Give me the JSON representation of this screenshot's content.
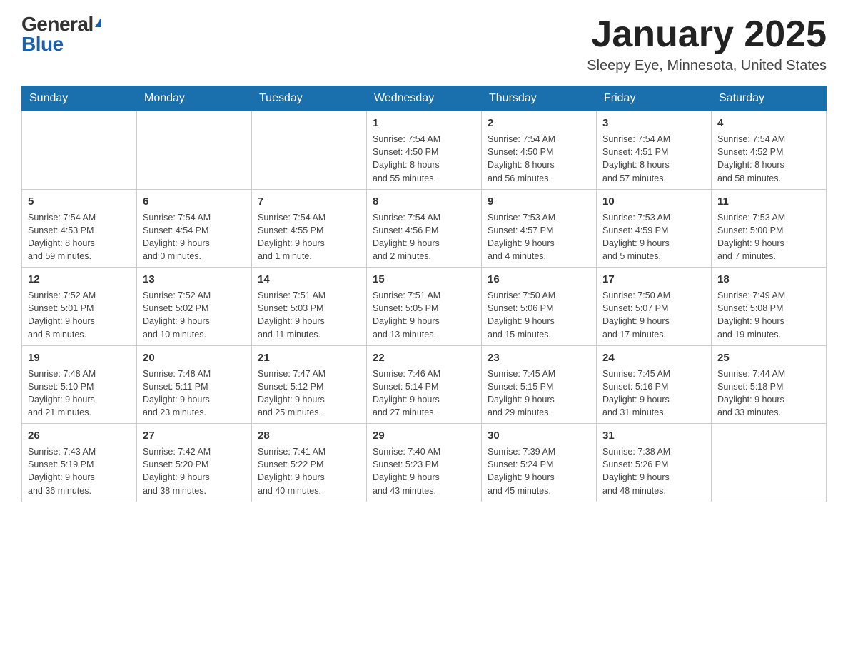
{
  "header": {
    "logo_general": "General",
    "logo_blue": "Blue",
    "month": "January 2025",
    "location": "Sleepy Eye, Minnesota, United States"
  },
  "days_of_week": [
    "Sunday",
    "Monday",
    "Tuesday",
    "Wednesday",
    "Thursday",
    "Friday",
    "Saturday"
  ],
  "weeks": [
    [
      {
        "day": "",
        "info": ""
      },
      {
        "day": "",
        "info": ""
      },
      {
        "day": "",
        "info": ""
      },
      {
        "day": "1",
        "info": "Sunrise: 7:54 AM\nSunset: 4:50 PM\nDaylight: 8 hours\nand 55 minutes."
      },
      {
        "day": "2",
        "info": "Sunrise: 7:54 AM\nSunset: 4:50 PM\nDaylight: 8 hours\nand 56 minutes."
      },
      {
        "day": "3",
        "info": "Sunrise: 7:54 AM\nSunset: 4:51 PM\nDaylight: 8 hours\nand 57 minutes."
      },
      {
        "day": "4",
        "info": "Sunrise: 7:54 AM\nSunset: 4:52 PM\nDaylight: 8 hours\nand 58 minutes."
      }
    ],
    [
      {
        "day": "5",
        "info": "Sunrise: 7:54 AM\nSunset: 4:53 PM\nDaylight: 8 hours\nand 59 minutes."
      },
      {
        "day": "6",
        "info": "Sunrise: 7:54 AM\nSunset: 4:54 PM\nDaylight: 9 hours\nand 0 minutes."
      },
      {
        "day": "7",
        "info": "Sunrise: 7:54 AM\nSunset: 4:55 PM\nDaylight: 9 hours\nand 1 minute."
      },
      {
        "day": "8",
        "info": "Sunrise: 7:54 AM\nSunset: 4:56 PM\nDaylight: 9 hours\nand 2 minutes."
      },
      {
        "day": "9",
        "info": "Sunrise: 7:53 AM\nSunset: 4:57 PM\nDaylight: 9 hours\nand 4 minutes."
      },
      {
        "day": "10",
        "info": "Sunrise: 7:53 AM\nSunset: 4:59 PM\nDaylight: 9 hours\nand 5 minutes."
      },
      {
        "day": "11",
        "info": "Sunrise: 7:53 AM\nSunset: 5:00 PM\nDaylight: 9 hours\nand 7 minutes."
      }
    ],
    [
      {
        "day": "12",
        "info": "Sunrise: 7:52 AM\nSunset: 5:01 PM\nDaylight: 9 hours\nand 8 minutes."
      },
      {
        "day": "13",
        "info": "Sunrise: 7:52 AM\nSunset: 5:02 PM\nDaylight: 9 hours\nand 10 minutes."
      },
      {
        "day": "14",
        "info": "Sunrise: 7:51 AM\nSunset: 5:03 PM\nDaylight: 9 hours\nand 11 minutes."
      },
      {
        "day": "15",
        "info": "Sunrise: 7:51 AM\nSunset: 5:05 PM\nDaylight: 9 hours\nand 13 minutes."
      },
      {
        "day": "16",
        "info": "Sunrise: 7:50 AM\nSunset: 5:06 PM\nDaylight: 9 hours\nand 15 minutes."
      },
      {
        "day": "17",
        "info": "Sunrise: 7:50 AM\nSunset: 5:07 PM\nDaylight: 9 hours\nand 17 minutes."
      },
      {
        "day": "18",
        "info": "Sunrise: 7:49 AM\nSunset: 5:08 PM\nDaylight: 9 hours\nand 19 minutes."
      }
    ],
    [
      {
        "day": "19",
        "info": "Sunrise: 7:48 AM\nSunset: 5:10 PM\nDaylight: 9 hours\nand 21 minutes."
      },
      {
        "day": "20",
        "info": "Sunrise: 7:48 AM\nSunset: 5:11 PM\nDaylight: 9 hours\nand 23 minutes."
      },
      {
        "day": "21",
        "info": "Sunrise: 7:47 AM\nSunset: 5:12 PM\nDaylight: 9 hours\nand 25 minutes."
      },
      {
        "day": "22",
        "info": "Sunrise: 7:46 AM\nSunset: 5:14 PM\nDaylight: 9 hours\nand 27 minutes."
      },
      {
        "day": "23",
        "info": "Sunrise: 7:45 AM\nSunset: 5:15 PM\nDaylight: 9 hours\nand 29 minutes."
      },
      {
        "day": "24",
        "info": "Sunrise: 7:45 AM\nSunset: 5:16 PM\nDaylight: 9 hours\nand 31 minutes."
      },
      {
        "day": "25",
        "info": "Sunrise: 7:44 AM\nSunset: 5:18 PM\nDaylight: 9 hours\nand 33 minutes."
      }
    ],
    [
      {
        "day": "26",
        "info": "Sunrise: 7:43 AM\nSunset: 5:19 PM\nDaylight: 9 hours\nand 36 minutes."
      },
      {
        "day": "27",
        "info": "Sunrise: 7:42 AM\nSunset: 5:20 PM\nDaylight: 9 hours\nand 38 minutes."
      },
      {
        "day": "28",
        "info": "Sunrise: 7:41 AM\nSunset: 5:22 PM\nDaylight: 9 hours\nand 40 minutes."
      },
      {
        "day": "29",
        "info": "Sunrise: 7:40 AM\nSunset: 5:23 PM\nDaylight: 9 hours\nand 43 minutes."
      },
      {
        "day": "30",
        "info": "Sunrise: 7:39 AM\nSunset: 5:24 PM\nDaylight: 9 hours\nand 45 minutes."
      },
      {
        "day": "31",
        "info": "Sunrise: 7:38 AM\nSunset: 5:26 PM\nDaylight: 9 hours\nand 48 minutes."
      },
      {
        "day": "",
        "info": ""
      }
    ]
  ]
}
